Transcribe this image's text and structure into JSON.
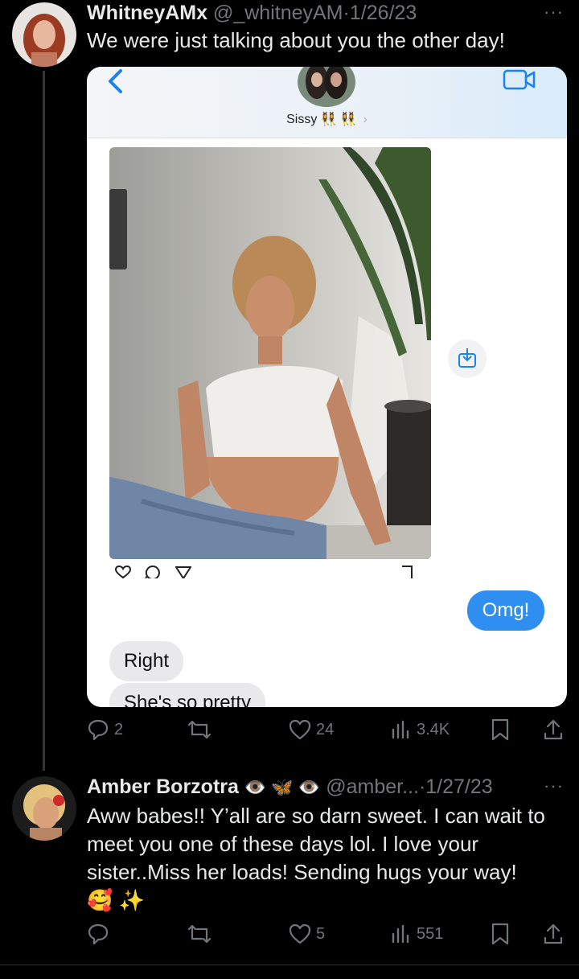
{
  "tweet1": {
    "name": "WhitneyAMx",
    "handle": "@_whitneyAM",
    "separator": "·",
    "date": "1/26/23",
    "text": "We were just talking about you the other day!",
    "more": "···",
    "media": {
      "contact_name": "Sissy 👯‍♀️ 👯‍♀️",
      "chevron": "›",
      "sent_message": "Omg!",
      "received_messages": [
        "Right",
        "She's so pretty"
      ]
    },
    "actions": {
      "replies": "2",
      "retweets": "",
      "likes": "24",
      "views": "3.4K"
    }
  },
  "tweet2": {
    "name": "Amber Borzotra",
    "name_emojis": "👁️ 🦋 👁️",
    "handle": "@amber...",
    "separator": "·",
    "date": "1/27/23",
    "text": "Aww babes!! Y’all are so darn sweet. I can wait to meet you one of these days lol. I love your sister..Miss her loads! Sending hugs your way!",
    "text_emojis": "🥰 ✨",
    "more": "···",
    "actions": {
      "replies": "",
      "retweets": "",
      "likes": "5",
      "views": "551"
    }
  },
  "colors": {
    "accent_blue": "#2f8ff0",
    "muted": "#71767b",
    "text": "#e7e9ea",
    "background": "#000000"
  },
  "icons": [
    "reply-icon",
    "retweet-icon",
    "like-icon",
    "views-icon",
    "bookmark-icon",
    "share-icon",
    "back-chevron-icon",
    "video-call-icon",
    "save-to-device-icon"
  ]
}
